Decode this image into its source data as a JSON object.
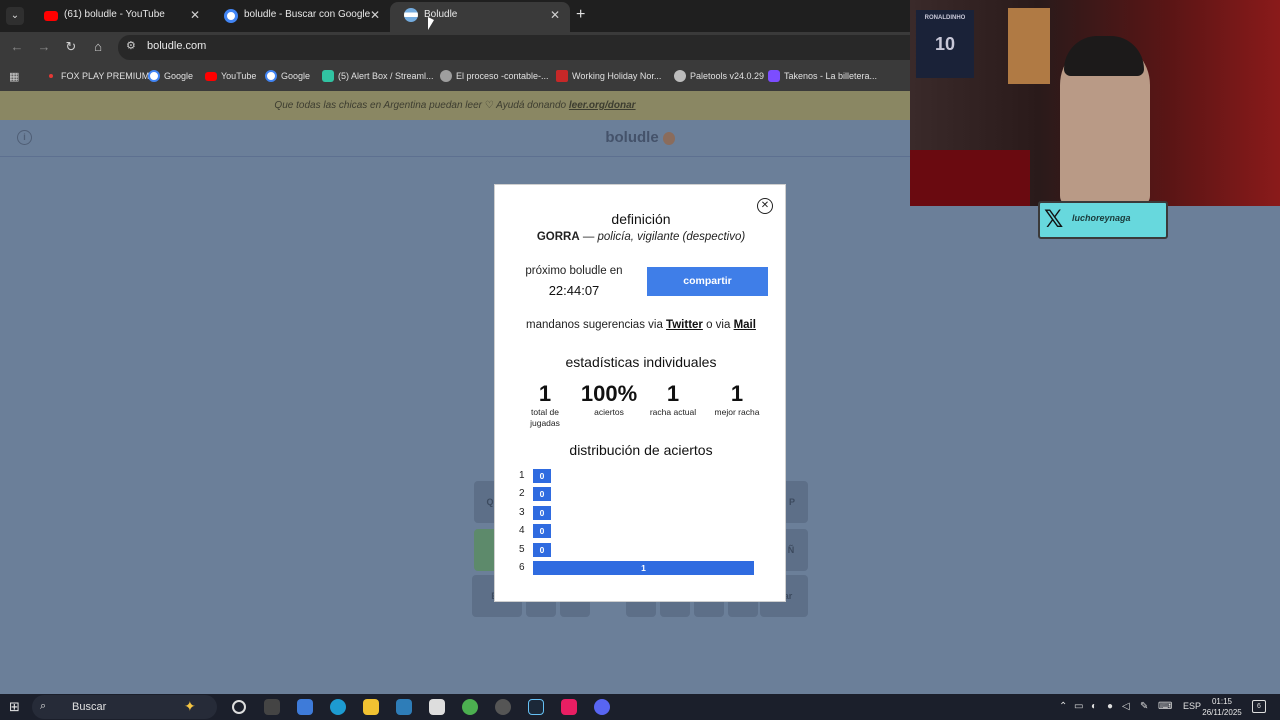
{
  "tabs": [
    {
      "title": "(61) boludle - YouTube",
      "icon": "youtube-icon",
      "color": "#ff0000"
    },
    {
      "title": "boludle - Buscar con Google",
      "icon": "google-icon",
      "color": "#4285f4"
    },
    {
      "title": "Boludle",
      "icon": "argentina-flag-icon",
      "color": "#74acdf",
      "active": true
    }
  ],
  "address_bar": {
    "url": "boludle.com"
  },
  "bookmarks": [
    {
      "label": "FOX PLAY PREMIUM",
      "color": "#e53935"
    },
    {
      "label": "Google",
      "color": "#4285f4"
    },
    {
      "label": "YouTube",
      "color": "#ff0000"
    },
    {
      "label": "Google",
      "color": "#4285f4"
    },
    {
      "label": "(5) Alert Box / Streaml...",
      "color": "#31c3a2"
    },
    {
      "label": "El proceso -contable-...",
      "color": "#9e9e9e"
    },
    {
      "label": "Working Holiday Nor...",
      "color": "#c62828"
    },
    {
      "label": "Paletools v24.0.29",
      "color": "#bdbdbd"
    },
    {
      "label": "Takenos - La billetera...",
      "color": "#7c4dff"
    }
  ],
  "banner": {
    "text": "Que todas las chicas en Argentina puedan leer ♡ Ayudá donando",
    "link": "leer.org/donar"
  },
  "site": {
    "title": "boludle"
  },
  "modal": {
    "title": "definición",
    "word": "GORRA",
    "dash": " — ",
    "meaning": "policía, vigilante (despectivo)",
    "next_label": "próximo boludle en",
    "next_time": "22:44:07",
    "share_label": "compartir",
    "suggest_prefix": "mandanos sugerencias via ",
    "suggest_link1": "Twitter",
    "suggest_mid": " o via ",
    "suggest_link2": "Mail",
    "stats_title": "estadísticas individuales",
    "stats": [
      {
        "value": "1",
        "label": "total de jugadas"
      },
      {
        "value": "100%",
        "label": "aciertos"
      },
      {
        "value": "1",
        "label": "racha actual"
      },
      {
        "value": "1",
        "label": "mejor racha"
      }
    ],
    "dist_title": "distribución de aciertos",
    "distribution": [
      {
        "guess": "1",
        "count": 0
      },
      {
        "guess": "2",
        "count": 0
      },
      {
        "guess": "3",
        "count": 0
      },
      {
        "guess": "4",
        "count": 0
      },
      {
        "guess": "5",
        "count": 0
      },
      {
        "guess": "6",
        "count": 1
      }
    ]
  },
  "keyboard": {
    "row1_left": "Q",
    "row1_right": "P",
    "row2_right": "Ñ",
    "row3_left": "En",
    "row3_right": "inar"
  },
  "webcam": {
    "poster_text": "10",
    "poster_name": "RONALDINHO",
    "tag": "luchoreynaga"
  },
  "taskbar": {
    "search_placeholder": "Buscar",
    "lang": "ESP",
    "time": "01:15",
    "date": "26/11/2025",
    "notif_count": "6"
  },
  "colors": {
    "accent": "#3f7ee8",
    "bar": "#2f6be0",
    "page_bg": "#6b7f99"
  }
}
